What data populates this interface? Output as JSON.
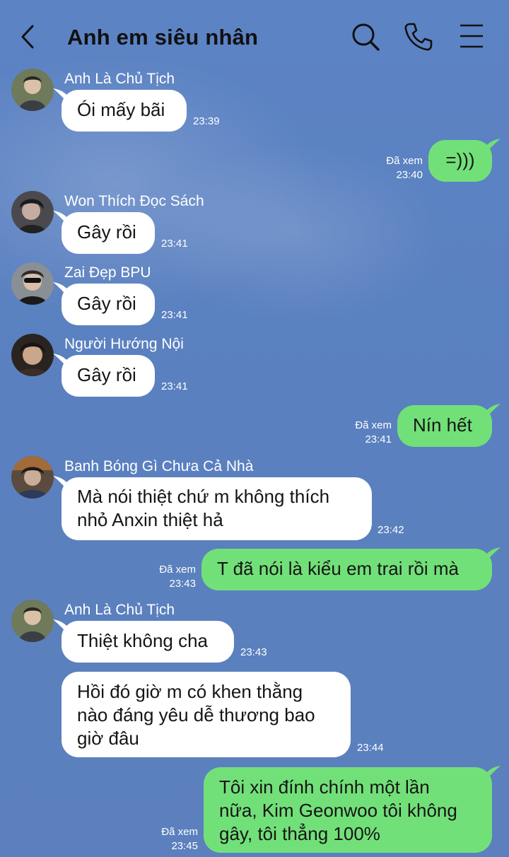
{
  "header": {
    "title": "Anh em siêu nhân",
    "icons": [
      "back-chevron",
      "search",
      "phone",
      "menu"
    ]
  },
  "colors": {
    "background": "#5a80bf",
    "incoming_bubble": "#ffffff",
    "outgoing_bubble": "#72e079",
    "text": "#151515"
  },
  "read_label": "Đã xem",
  "messages": [
    {
      "sender": "Anh Là Chủ Tịch",
      "text": "Ói mấy bãi",
      "time": "23:39"
    },
    {
      "text": "=)))",
      "time": "23:40",
      "status": "Đã xem"
    },
    {
      "sender": "Won Thích Đọc Sách",
      "text": "Gây rồi",
      "time": "23:41"
    },
    {
      "sender": "Zai Đẹp BPU",
      "text": "Gây rồi",
      "time": "23:41"
    },
    {
      "sender": "Người Hướng Nội",
      "text": "Gây rồi",
      "time": "23:41"
    },
    {
      "text": "Nín hết",
      "time": "23:41",
      "status": "Đã xem"
    },
    {
      "sender": "Banh Bóng Gì Chưa Cả Nhà",
      "text": "Mà nói thiệt chứ m không thích\nnhỏ Anxin thiệt hả",
      "time": "23:42"
    },
    {
      "text": "T đã nói là kiểu em trai rồi mà",
      "time": "23:43",
      "status": "Đã xem"
    },
    {
      "sender": "Anh Là Chủ Tịch",
      "text": "Thiệt không cha",
      "time": "23:43"
    },
    {
      "text": "Hồi đó giờ m có khen thằng\nnào đáng yêu dễ thương bao\ngiờ đâu",
      "time": "23:44"
    },
    {
      "text": "Tôi xin đính chính một lần\nnữa, Kim Geonwoo tôi không\ngây, tôi thẳng 100%",
      "time": "23:45",
      "status": "Đã xem"
    }
  ]
}
